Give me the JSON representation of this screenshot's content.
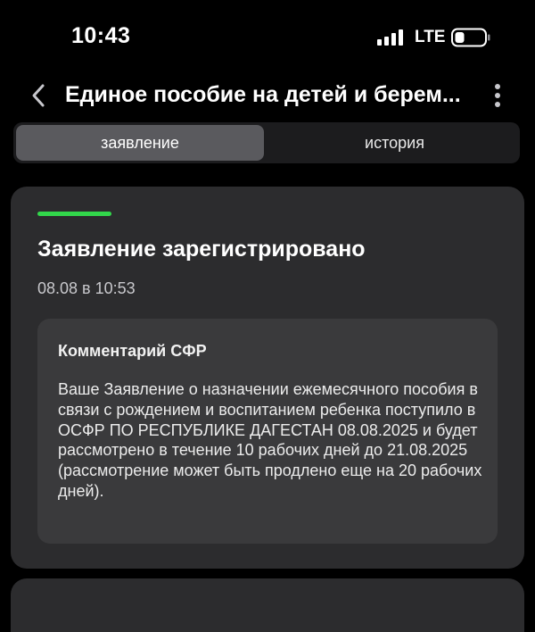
{
  "status_bar": {
    "time": "10:43",
    "network": "LTE"
  },
  "nav": {
    "title": "Единое пособие на детей и берем..."
  },
  "tabs": [
    {
      "label": "заявление",
      "active": true
    },
    {
      "label": "история",
      "active": false
    }
  ],
  "application": {
    "status_color": "#32d74b",
    "title": "Заявление зарегистрировано",
    "date": "08.08 в 10:53",
    "comment": {
      "title": "Комментарий СФР",
      "text": "Ваше Заявление о назначении ежемесячного пособия в связи с рождением и воспитанием ребенка поступило в ОСФР ПО РЕСПУБЛИКЕ ДАГЕСТАН 08.08.2025 и будет рассмотрено в течение 10 рабочих дней до 21.08.2025 (рассмотрение может быть продлено еще на 20 рабочих дней)."
    }
  },
  "icons": {
    "signal": "cellular-signal-icon",
    "battery": "battery-icon",
    "back": "chevron-left-icon",
    "more": "more-vertical-icon"
  },
  "colors": {
    "background": "#000000",
    "card": "#2c2c2e",
    "comment_box": "#3a3a3c",
    "segment_active": "#5a5a5e"
  }
}
